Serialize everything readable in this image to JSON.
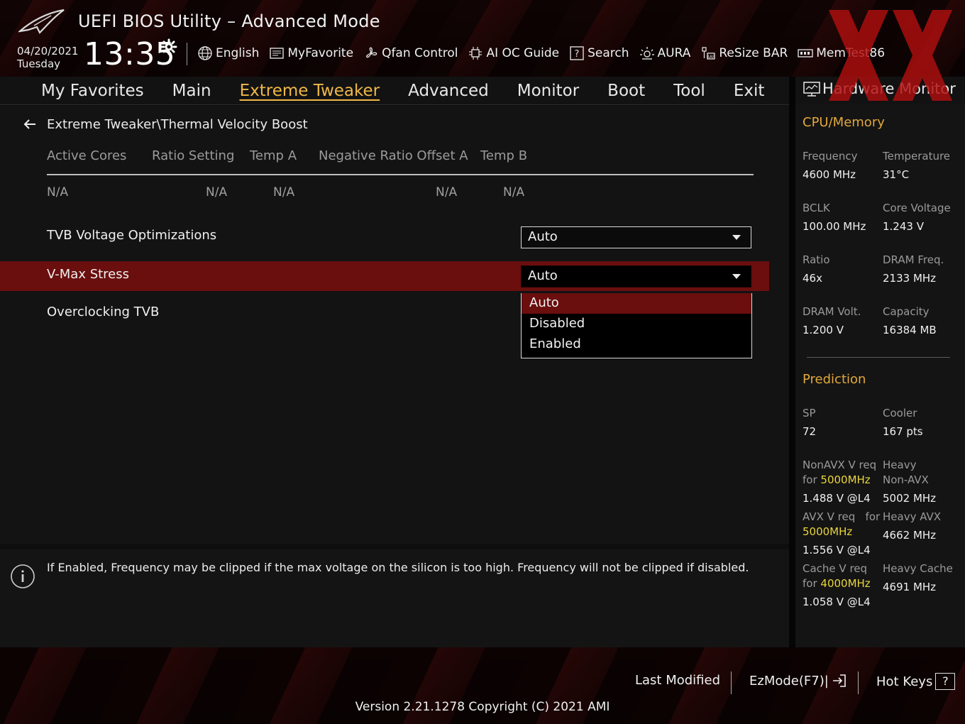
{
  "header": {
    "title": "UEFI BIOS Utility – Advanced Mode",
    "date": "04/20/2021",
    "day": "Tuesday",
    "time": "13:35",
    "toolbar": [
      {
        "label": "English",
        "icon": "globe-icon"
      },
      {
        "label": "MyFavorite",
        "icon": "favorite-icon"
      },
      {
        "label": "Qfan Control",
        "icon": "fan-icon"
      },
      {
        "label": "AI OC Guide",
        "icon": "chip-icon"
      },
      {
        "label": "Search",
        "icon": "question-icon"
      },
      {
        "label": "AURA",
        "icon": "aura-icon"
      },
      {
        "label": "ReSize BAR",
        "icon": "resize-bar-icon"
      },
      {
        "label": "MemTest86",
        "icon": "memory-icon"
      }
    ]
  },
  "nav": {
    "tabs": [
      "My Favorites",
      "Main",
      "Extreme Tweaker",
      "Advanced",
      "Monitor",
      "Boot",
      "Tool",
      "Exit"
    ],
    "active": "Extreme Tweaker"
  },
  "main": {
    "breadcrumb": "Extreme Tweaker\\Thermal Velocity Boost",
    "columns": [
      "Active Cores",
      "Ratio Setting",
      "Temp A",
      "Negative Ratio Offset A",
      "Temp B"
    ],
    "values": [
      "N/A",
      "N/A",
      "N/A",
      "N/A",
      "N/A"
    ],
    "settings": [
      {
        "label": "TVB Voltage Optimizations",
        "value": "Auto"
      },
      {
        "label": "V-Max Stress",
        "value": "Auto"
      },
      {
        "label": "Overclocking TVB",
        "value": ""
      }
    ],
    "dropdown_options": [
      "Auto",
      "Disabled",
      "Enabled"
    ],
    "help_text": "If Enabled, Frequency may be clipped if the max voltage on the silicon is too high. Frequency will not be clipped if disabled."
  },
  "hw": {
    "title": "Hardware Monitor",
    "cpu_section": "CPU/Memory",
    "frequency_label": "Frequency",
    "frequency": "4600 MHz",
    "temperature_label": "Temperature",
    "temperature": "31°C",
    "bclk_label": "BCLK",
    "bclk": "100.00 MHz",
    "core_voltage_label": "Core Voltage",
    "core_voltage": "1.243 V",
    "ratio_label": "Ratio",
    "ratio": "46x",
    "dram_freq_label": "DRAM Freq.",
    "dram_freq": "2133 MHz",
    "dram_volt_label": "DRAM Volt.",
    "dram_volt": "1.200 V",
    "capacity_label": "Capacity",
    "capacity": "16384 MB",
    "prediction_section": "Prediction",
    "sp_label": "SP",
    "sp": "72",
    "cooler_label": "Cooler",
    "cooler": "167 pts",
    "nonavx_label_a": "NonAVX V req",
    "nonavx_for": "for",
    "nonavx_freq": "5000MHz",
    "nonavx_value": "1.488 V @L4",
    "heavy_nonavx_label_a": "Heavy",
    "heavy_nonavx_label_b": "Non-AVX",
    "heavy_nonavx_value": "5002 MHz",
    "avx_label_a": "AVX V req",
    "avx_for": "for",
    "avx_freq": "5000MHz",
    "avx_value": "1.556 V @L4",
    "heavy_avx_label": "Heavy AVX",
    "heavy_avx_value": "4662 MHz",
    "cache_label_a": "Cache V req",
    "cache_for": "for",
    "cache_freq": "4000MHz",
    "cache_value": "1.058 V @L4",
    "heavy_cache_label": "Heavy Cache",
    "heavy_cache_value": "4691 MHz"
  },
  "footer": {
    "last_modified": "Last Modified",
    "ezmode": "EzMode(F7)|",
    "hot_keys": "Hot Keys",
    "hot_keys_key": "?",
    "version": "Version 2.21.1278 Copyright (C) 2021 AMI"
  },
  "colors": {
    "accent": "#f0b847",
    "selected_row": "#6a0e0e",
    "section_title": "#e2a83a",
    "highlight_freq": "#e9d53a"
  }
}
